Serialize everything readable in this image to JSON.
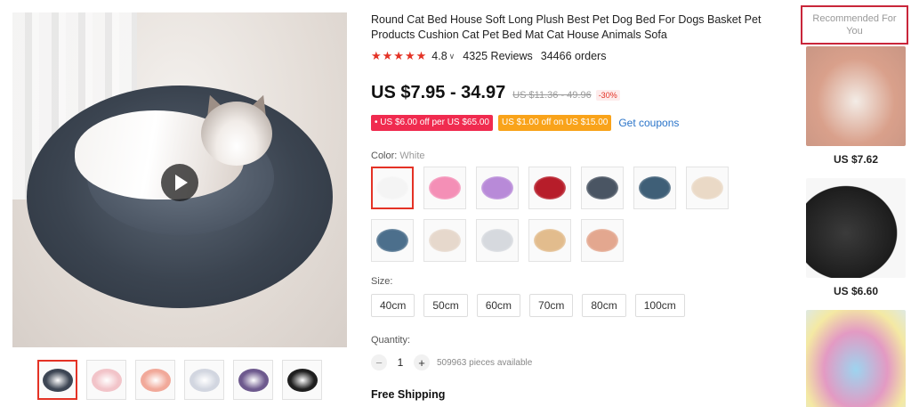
{
  "product": {
    "title": "Round Cat Bed House Soft Long Plush Best Pet Dog Bed For Dogs Basket Pet Products Cushion Cat Pet Bed Mat Cat House Animals Sofa",
    "stars": "★★★★★",
    "rating": "4.8",
    "reviews": "4325 Reviews",
    "orders": "34466 orders",
    "price": "US $7.95 - 34.97",
    "old_price": "US $11.36 - 49.96",
    "discount": "-30%",
    "coupons": [
      {
        "label": "• US $6.00 off per US $65.00",
        "color": "#f02b4f"
      },
      {
        "label": "US $1.00 off on US $15.00",
        "color": "#f9a31a"
      }
    ],
    "get_coupons": "Get coupons",
    "color_label": "Color:",
    "color_value": "White",
    "swatch_colors": [
      "#f4f4f4",
      "#f48fb6",
      "#b88ad8",
      "#b71d2a",
      "#4a5563",
      "#3f5f77",
      "#ead9c6",
      "#4c6f8c",
      "#e6d8cc",
      "#d6d9de",
      "#e2bc8d",
      "#e3a78f"
    ],
    "size_label": "Size:",
    "sizes": [
      "40cm",
      "50cm",
      "60cm",
      "70cm",
      "80cm",
      "100cm"
    ],
    "quantity_label": "Quantity:",
    "quantity": "1",
    "available": "509963 pieces available",
    "shipping": "Free Shipping"
  },
  "gallery": {
    "thumb_colors": [
      "#3d4654",
      "#f2c4c9",
      "#f1a99a",
      "#d2d6e0",
      "#6e5a8e",
      "#1f1f1f"
    ],
    "play_icon": "play-icon"
  },
  "recommended": {
    "header": "Recommended For You",
    "items": [
      {
        "price": "US $7.62",
        "color": "#d9a08b"
      },
      {
        "price": "US $6.60",
        "color": "#1c1c1c"
      },
      {
        "price": "",
        "color": "#e39ac3"
      }
    ]
  },
  "colors": {
    "accent": "#e43225",
    "link": "#2a74c9",
    "rec_border": "#c9263a"
  }
}
